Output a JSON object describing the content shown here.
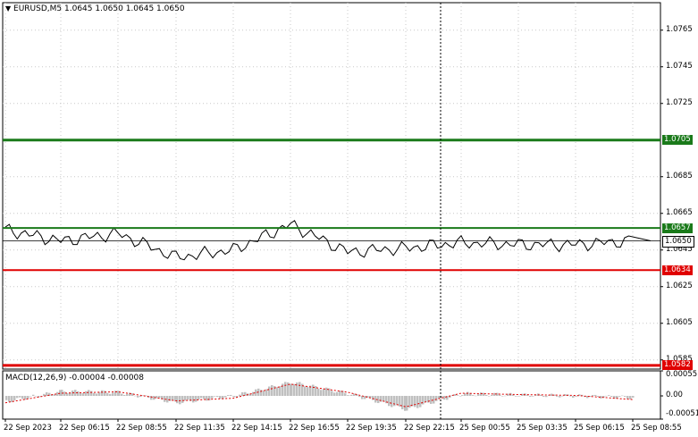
{
  "window": {
    "symbol_line": "EURUSD,M5  1.0645 1.0650 1.0645 1.0650",
    "collapse_icon": "triangle-down-icon"
  },
  "price_axis": {
    "labels": [
      "1.0765",
      "1.0745",
      "1.0725",
      "1.0685",
      "1.0665",
      "1.0645",
      "1.0625",
      "1.0605",
      "1.0585"
    ]
  },
  "levels": [
    {
      "name": "top-resistance",
      "price": 1.0705,
      "label": "1.0705",
      "color": "#1a7a1a"
    },
    {
      "name": "buy-level",
      "price": 1.0657,
      "label": "1.0657",
      "color": "#1a7a1a"
    },
    {
      "name": "current-price",
      "price": 1.065,
      "label": "1.0650",
      "color": "#000000"
    },
    {
      "name": "sell-level",
      "price": 1.0634,
      "label": "1.0634",
      "color": "#e00000"
    },
    {
      "name": "bottom-support",
      "price": 1.0582,
      "label": "1.0582",
      "color": "#e00000"
    }
  ],
  "macd": {
    "title": "MACD(12,26,9) -0.00004 -0.00008",
    "axis_labels": [
      "0.00055",
      "0.00",
      "-0.00051"
    ]
  },
  "time_axis": {
    "labels": [
      "22 Sep 2023",
      "22 Sep 06:15",
      "22 Sep 08:55",
      "22 Sep 11:35",
      "22 Sep 14:15",
      "22 Sep 16:55",
      "22 Sep 19:35",
      "22 Sep 22:15",
      "25 Sep 00:55",
      "25 Sep 03:35",
      "25 Sep 06:15",
      "25 Sep 08:55"
    ]
  },
  "chart_data": {
    "type": "line",
    "symbol": "EURUSD",
    "timeframe": "M5",
    "ylim": [
      1.058,
      1.078
    ],
    "x": [
      "22 Sep 2023",
      "22 Sep 06:15",
      "22 Sep 08:55",
      "22 Sep 11:35",
      "22 Sep 14:15",
      "22 Sep 16:55",
      "22 Sep 19:35",
      "22 Sep 22:15",
      "25 Sep 00:55",
      "25 Sep 03:35",
      "25 Sep 06:15",
      "25 Sep 08:55"
    ],
    "series": [
      {
        "name": "EURUSD",
        "values": [
          1.0656,
          1.065,
          1.0654,
          1.0641,
          1.0645,
          1.0659,
          1.0644,
          1.0646,
          1.0649,
          1.0648,
          1.0648,
          1.065
        ]
      }
    ],
    "macd_ylim": [
      -0.00051,
      0.00055
    ],
    "macd_histogram": [
      -0.00012,
      0.0001,
      8e-05,
      -0.00015,
      0.0,
      0.0003,
      5e-05,
      -0.0003,
      5e-05,
      2e-05,
      0.0,
      -4e-05
    ],
    "macd_signal": [
      -0.00015,
      6e-05,
      9e-05,
      -0.00011,
      -5e-05,
      0.00026,
      8e-05,
      -0.00024,
      6e-05,
      3e-05,
      1e-05,
      -8e-05
    ]
  }
}
